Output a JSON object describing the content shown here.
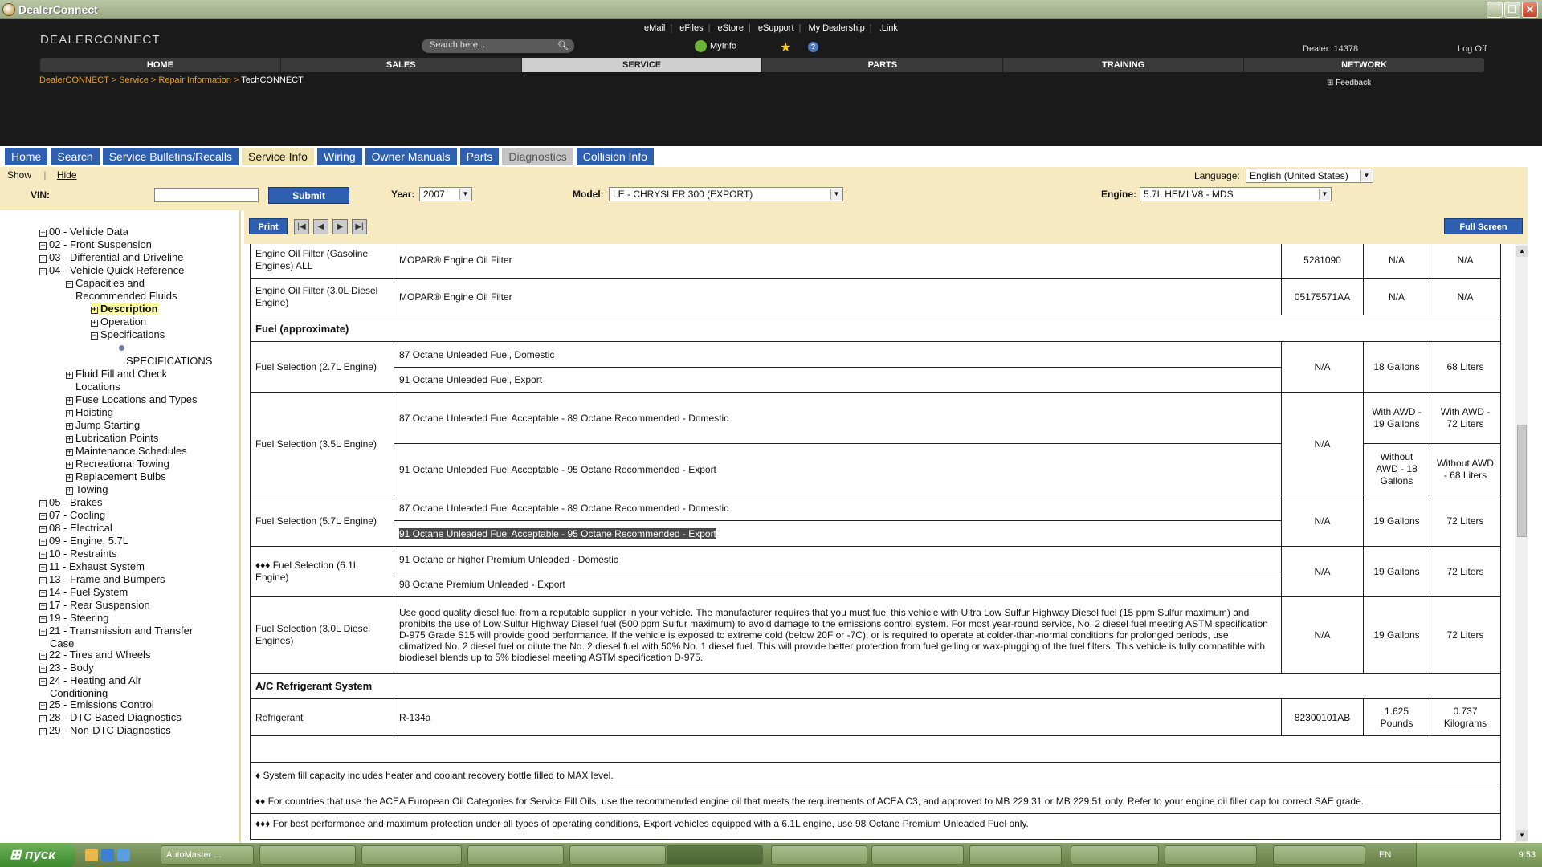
{
  "window": {
    "title": "DealerConnect"
  },
  "header": {
    "logo": "DEALERCONNECT",
    "top_links": [
      "eMail",
      "eFiles",
      "eStore",
      "eSupport",
      "My Dealership",
      ".Link"
    ],
    "search_placeholder": "Search here...",
    "myinfo": "MyInfo",
    "dealer": "Dealer: 14378",
    "logoff": "Log Off",
    "nav": [
      "HOME",
      "SALES",
      "SERVICE",
      "PARTS",
      "TRAINING",
      "NETWORK"
    ],
    "nav_active": "SERVICE",
    "breadcrumb": [
      "DealerCONNECT",
      "Service",
      "Repair Information",
      "TechCONNECT"
    ],
    "feedback": "Feedback"
  },
  "tabs": [
    {
      "label": "Home",
      "state": "normal"
    },
    {
      "label": "Search",
      "state": "normal"
    },
    {
      "label": "Service Bulletins/Recalls",
      "state": "normal"
    },
    {
      "label": "Service Info",
      "state": "active"
    },
    {
      "label": "Wiring",
      "state": "normal"
    },
    {
      "label": "Owner Manuals",
      "state": "normal"
    },
    {
      "label": "Parts",
      "state": "normal"
    },
    {
      "label": "Diagnostics",
      "state": "disabled"
    },
    {
      "label": "Collision Info",
      "state": "normal"
    }
  ],
  "filters": {
    "show": "Show",
    "hide": "Hide",
    "vin_label": "VIN:",
    "vin_value": "",
    "submit": "Submit",
    "year_label": "Year:",
    "year": "2007",
    "model_label": "Model:",
    "model": "LE - CHRYSLER 300 (EXPORT)",
    "engine_label": "Engine:",
    "engine": "5.7L HEMI V8 - MDS",
    "language_label": "Language:",
    "language": "English (United States)"
  },
  "tree": [
    {
      "label": "00 - Vehicle Data",
      "box": "+"
    },
    {
      "label": "02 - Front Suspension",
      "box": "+"
    },
    {
      "label": "03 - Differential and Driveline",
      "box": "+"
    },
    {
      "label": "04 - Vehicle Quick Reference",
      "box": "-"
    },
    {
      "label": "Capacities and",
      "box": "-"
    },
    {
      "label": "Recommended Fluids",
      "box": ""
    },
    {
      "label": "Description",
      "box": "+"
    },
    {
      "label": "Operation",
      "box": "+"
    },
    {
      "label": "Specifications",
      "box": "-"
    },
    {
      "label": "SPECIFICATIONS",
      "box": ""
    },
    {
      "label": "Fluid Fill and Check",
      "box": "+"
    },
    {
      "label": "Locations",
      "box": ""
    },
    {
      "label": "Fuse Locations and Types",
      "box": "+"
    },
    {
      "label": "Hoisting",
      "box": "+"
    },
    {
      "label": "Jump Starting",
      "box": "+"
    },
    {
      "label": "Lubrication Points",
      "box": "+"
    },
    {
      "label": "Maintenance Schedules",
      "box": "+"
    },
    {
      "label": "Recreational Towing",
      "box": "+"
    },
    {
      "label": "Replacement Bulbs",
      "box": "+"
    },
    {
      "label": "Towing",
      "box": "+"
    },
    {
      "label": "05 - Brakes",
      "box": "+"
    },
    {
      "label": "07 - Cooling",
      "box": "+"
    },
    {
      "label": "08 - Electrical",
      "box": "+"
    },
    {
      "label": "09 - Engine, 5.7L",
      "box": "+"
    },
    {
      "label": "10 - Restraints",
      "box": "+"
    },
    {
      "label": "11 - Exhaust System",
      "box": "+"
    },
    {
      "label": "13 - Frame and Bumpers",
      "box": "+"
    },
    {
      "label": "14 - Fuel System",
      "box": "+"
    },
    {
      "label": "17 - Rear Suspension",
      "box": "+"
    },
    {
      "label": "19 - Steering",
      "box": "+"
    },
    {
      "label": "21 - Transmission and Transfer",
      "box": "+"
    },
    {
      "label": "Case",
      "box": ""
    },
    {
      "label": "22 - Tires and Wheels",
      "box": "+"
    },
    {
      "label": "23 - Body",
      "box": "+"
    },
    {
      "label": "24 - Heating and Air",
      "box": "+"
    },
    {
      "label": "Conditioning",
      "box": ""
    },
    {
      "label": "25 - Emissions Control",
      "box": "+"
    },
    {
      "label": "28 - DTC-Based Diagnostics",
      "box": "+"
    },
    {
      "label": "29 - Non-DTC Diagnostics",
      "box": "+"
    }
  ],
  "toolbar": {
    "print": "Print",
    "fullscreen": "Full Screen",
    "nav_icons": [
      "first",
      "prev",
      "next",
      "last"
    ]
  },
  "table": {
    "rows": [
      {
        "item": "Engine Oil Filter (Gasoline Engines) ALL",
        "desc": "MOPAR® Engine Oil Filter",
        "part": "5281090",
        "us": "N/A",
        "metric": "N/A"
      },
      {
        "item": "Engine Oil Filter (3.0L Diesel Engine)",
        "desc": "MOPAR® Engine Oil Filter",
        "part": "05175571AA",
        "us": "N/A",
        "metric": "N/A"
      },
      {
        "section": "Fuel (approximate)"
      },
      {
        "item": "Fuel Selection (2.7L Engine)",
        "desc": [
          "87 Octane Unleaded Fuel, Domestic",
          "91 Octane Unleaded Fuel, Export"
        ],
        "part": "N/A",
        "us": "18 Gallons",
        "metric": "68 Liters"
      },
      {
        "item": "Fuel Selection (3.5L Engine)",
        "desc": [
          "87 Octane Unleaded Fuel Acceptable - 89 Octane Recommended - Domestic",
          "91 Octane Unleaded Fuel Acceptable - 95 Octane Recommended - Export"
        ],
        "part": "N/A",
        "us": [
          "With AWD - 19 Gallons",
          "Without AWD - 18 Gallons"
        ],
        "metric": [
          "With AWD - 72 Liters",
          "Without AWD - 68 Liters"
        ]
      },
      {
        "item": "Fuel Selection (5.7L Engine)",
        "desc": [
          "87 Octane Unleaded Fuel Acceptable - 89 Octane Recommended - Domestic",
          "91 Octane Unleaded Fuel Acceptable - 95 Octane Recommended - Export"
        ],
        "part": "N/A",
        "us": "19 Gallons",
        "metric": "72 Liters"
      },
      {
        "item": "♦♦♦ Fuel Selection (6.1L Engine)",
        "desc": [
          "91 Octane or higher Premium Unleaded - Domestic",
          "98 Octane Premium Unleaded - Export"
        ],
        "part": "N/A",
        "us": "19 Gallons",
        "metric": "72 Liters"
      },
      {
        "item": "Fuel Selection (3.0L Diesel Engines)",
        "desc": "Use good quality diesel fuel from a reputable supplier in your vehicle. The manufacturer requires that you must fuel this vehicle with Ultra Low Sulfur Highway Diesel fuel (15 ppm Sulfur maximum) and prohibits the use of Low Sulfur Highway Diesel fuel (500 ppm Sulfur maximum) to avoid damage to the emissions control system. For most year-round service, No. 2 diesel fuel meeting ASTM specification D-975 Grade S15 will provide good performance. If the vehicle is exposed to extreme cold (below 20F or -7C), or is required to operate at colder-than-normal conditions for prolonged periods, use climatized No. 2 diesel fuel or dilute the No. 2 diesel fuel with 50% No. 1 diesel fuel. This will provide better protection from fuel gelling or wax-plugging of the fuel filters. This vehicle is fully compatible with biodiesel blends up to 5% biodiesel meeting ASTM specification D-975.",
        "part": "N/A",
        "us": "19 Gallons",
        "metric": "72 Liters"
      },
      {
        "section": "A/C Refrigerant System"
      },
      {
        "item": "Refrigerant",
        "desc": "R-134a",
        "part": "82300101AB",
        "us": "1.625 Pounds",
        "metric": "0.737 Kilograms"
      }
    ],
    "notes": [
      "♦ System fill capacity includes heater and coolant recovery bottle filled to MAX level.",
      "♦♦ For countries that use the ACEA European Oil Categories for Service Fill Oils, use the recommended engine oil that meets the requirements of ACEA C3, and approved to MB 229.31 or MB 229.51 only. Refer to your engine oil filler cap for correct SAE grade.",
      "♦♦♦ For best performance and maximum protection under all types of operating conditions, Export vehicles equipped with a 6.1L engine, use 98 Octane Premium Unleaded Fuel only."
    ]
  },
  "taskbar": {
    "start": "пуск",
    "tasks": [
      "AutoMaster ...",
      "",
      "",
      "",
      "",
      "",
      "",
      "",
      "",
      "",
      "",
      "",
      ""
    ],
    "lang": "EN",
    "clock": "9:53"
  }
}
